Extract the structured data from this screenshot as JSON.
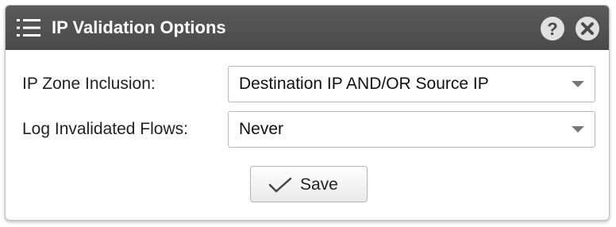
{
  "dialog": {
    "title": "IP Validation Options",
    "icons": {
      "menu": "list-menu-icon",
      "help": "help-icon",
      "close": "close-icon"
    },
    "help_glyph": "?",
    "colors": {
      "titlebar": "#4f4f4f",
      "round_button": "#e0e0e0"
    }
  },
  "form": {
    "ip_zone_inclusion": {
      "label": "IP Zone Inclusion:",
      "value": "Destination IP AND/OR Source IP"
    },
    "log_invalidated_flows": {
      "label": "Log Invalidated Flows:",
      "value": "Never"
    }
  },
  "actions": {
    "save_label": "Save",
    "save_icon": "checkmark-icon"
  }
}
